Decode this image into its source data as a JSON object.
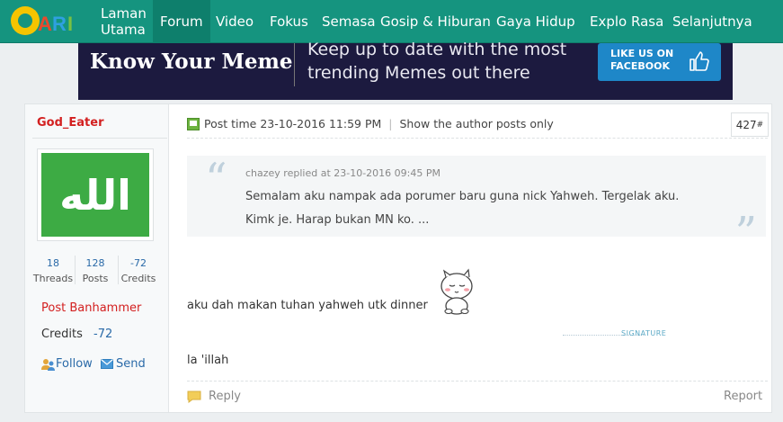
{
  "nav": {
    "logo_text": "CARI",
    "items": [
      {
        "label": "Laman",
        "label2": "Utama"
      },
      {
        "label": "Forum"
      },
      {
        "label": "Video"
      },
      {
        "label": "Fokus"
      },
      {
        "label": "Semasa"
      },
      {
        "label": "Gosip & Hiburan"
      },
      {
        "label": "Gaya Hidup"
      },
      {
        "label": "Explo Rasa"
      },
      {
        "label": "Selanjutnya"
      }
    ],
    "active": "Forum",
    "color": "#15947f"
  },
  "ad": {
    "brand": "Know Your Meme",
    "tagline": "Keep up to date with the most trending Memes out there",
    "cta_line1": "LIKE US ON",
    "cta_line2": "FACEBOOK"
  },
  "author": {
    "name": "God_Eater",
    "avatar_glyph": "الله",
    "stats": [
      {
        "value": "18",
        "label": "Threads"
      },
      {
        "value": "128",
        "label": "Posts"
      },
      {
        "value": "-72",
        "label": "Credits"
      }
    ],
    "group": "Post Banhammer",
    "credits_label": "Credits",
    "credits_value": "-72",
    "follow_label": "Follow",
    "send_label": "Send"
  },
  "post": {
    "time_label": "Post time 23-10-2016 11:59 PM",
    "author_only_label": "Show the author posts only",
    "floor": "427",
    "floor_sup": "#",
    "quote": {
      "meta": "chazey replied at 23-10-2016 09:45 PM",
      "text": "Semalam aku nampak ada porumer baru guna nick Yahweh. Tergelak aku.  Kimk je. Harap bukan MN ko.   ..."
    },
    "message": "aku dah makan tuhan yahweh utk dinner",
    "signature_label": "SIGNATURE",
    "signature": "la 'illah",
    "reply_label": "Reply",
    "report_label": "Report"
  }
}
